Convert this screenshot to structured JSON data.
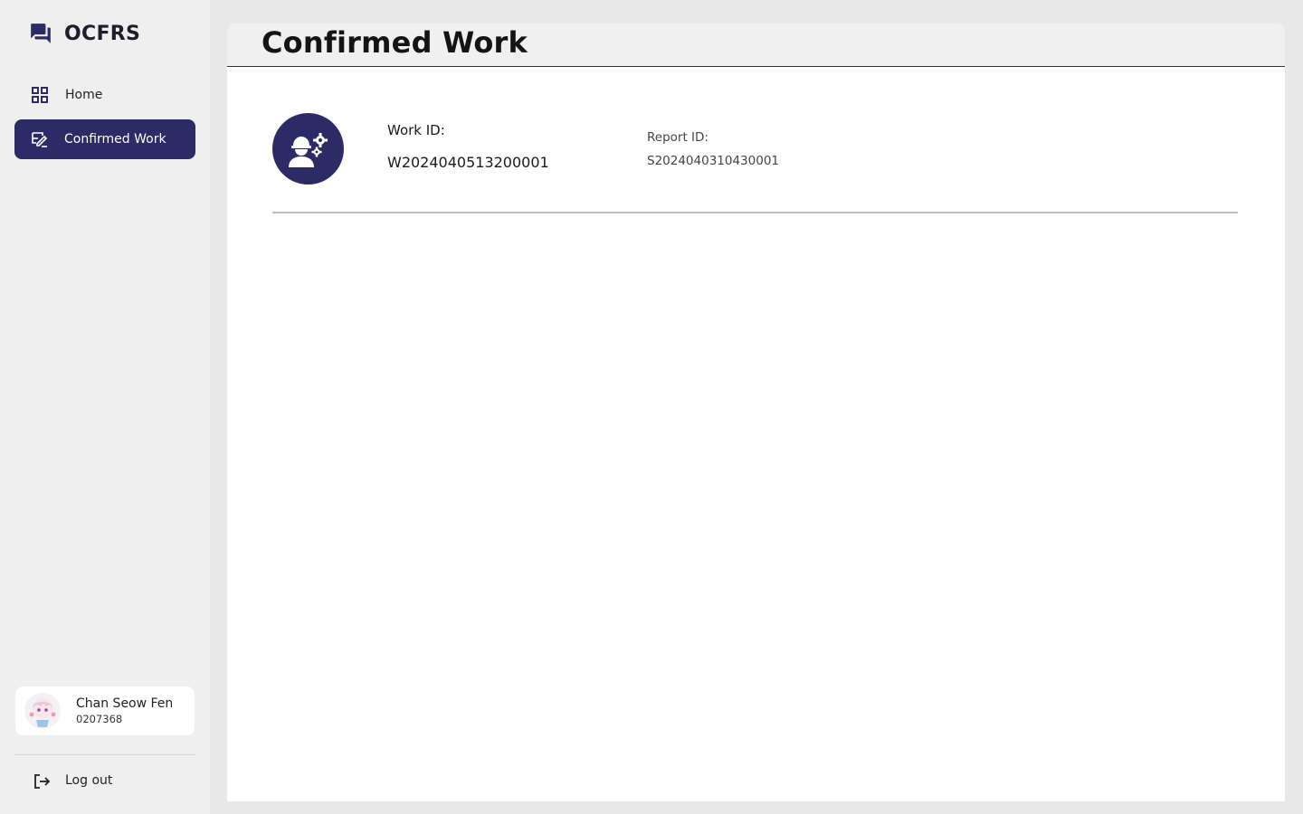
{
  "brand": {
    "name": "OCFRS",
    "icon": "chat-bubbles-icon"
  },
  "nav": {
    "items": [
      {
        "label": "Home",
        "icon": "grid-icon",
        "active": false
      },
      {
        "label": "Confirmed Work",
        "icon": "confirmed-work-icon",
        "active": true
      }
    ]
  },
  "user": {
    "name": "Chan Seow Fen",
    "id": "0207368"
  },
  "logout": {
    "label": "Log out",
    "icon": "logout-icon"
  },
  "page": {
    "title": "Confirmed Work"
  },
  "works": [
    {
      "icon": "worker-gears-icon",
      "work_id_label": "Work ID:",
      "work_id": "W2024040513200001",
      "report_id_label": "Report ID:",
      "report_id": "S2024040310430001"
    }
  ],
  "colors": {
    "accent": "#2d2b66",
    "sidebar_bg": "#efefef",
    "page_bg": "#e8e8e8",
    "panel_bg": "#ffffff"
  }
}
